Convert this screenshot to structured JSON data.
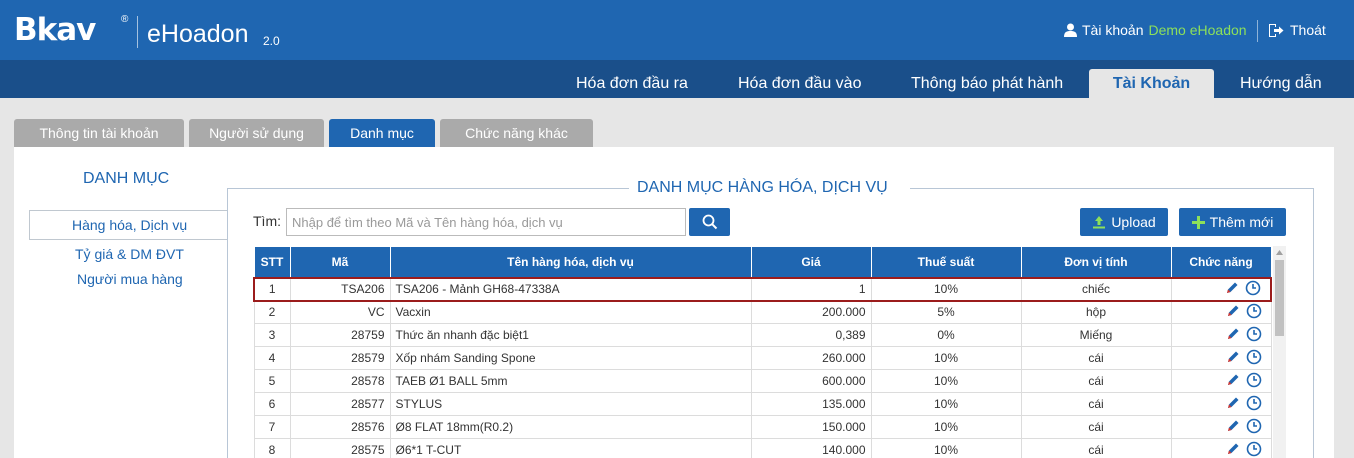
{
  "header": {
    "logo": "Bkav",
    "logo_reg": "®",
    "product": "eHoadon",
    "version": "2.0",
    "account_label": "Tài khoản",
    "account_name": "Demo eHoadon",
    "logout_label": "Thoát"
  },
  "main_nav": {
    "items": [
      "Hóa đơn đầu ra",
      "Hóa đơn đầu vào",
      "Thông báo phát hành",
      "Tài Khoản",
      "Hướng dẫn"
    ],
    "active": "Tài Khoản"
  },
  "sub_tabs": {
    "items": [
      "Thông tin tài khoản",
      "Người sử dụng",
      "Danh mục",
      "Chức năng khác"
    ],
    "active": "Danh mục"
  },
  "left_menu": {
    "title": "DANH MỤC",
    "items": [
      "Hàng hóa, Dịch vụ",
      "Tỷ giá & DM ĐVT",
      "Người mua hàng"
    ],
    "active": "Hàng hóa, Dịch vụ"
  },
  "section_title": "DANH MỤC HÀNG HÓA, DỊCH VỤ",
  "search": {
    "label": "Tìm:",
    "placeholder": "Nhập để tìm theo Mã và Tên hàng hóa, dịch vụ",
    "value": ""
  },
  "buttons": {
    "upload": "Upload",
    "add_new": "Thêm mới"
  },
  "table": {
    "columns": [
      "STT",
      "Mã",
      "Tên hàng hóa, dịch vụ",
      "Giá",
      "Thuế suất",
      "Đơn vị tính",
      "Chức năng"
    ],
    "rows": [
      {
        "stt": "1",
        "ma": "TSA206",
        "ten": "TSA206 - Mảnh GH68-47338A",
        "gia": "1",
        "thue": "10%",
        "dvt": "chiếc",
        "selected": true
      },
      {
        "stt": "2",
        "ma": "VC",
        "ten": "Vacxin",
        "gia": "200.000",
        "thue": "5%",
        "dvt": "hộp"
      },
      {
        "stt": "3",
        "ma": "28759",
        "ten": "Thức ăn nhanh đặc biệt1",
        "gia": "0,389",
        "thue": "0%",
        "dvt": "Miếng"
      },
      {
        "stt": "4",
        "ma": "28579",
        "ten": "Xốp nhám Sanding Spone",
        "gia": "260.000",
        "thue": "10%",
        "dvt": "cái"
      },
      {
        "stt": "5",
        "ma": "28578",
        "ten": "TAEB Ø1 BALL 5mm",
        "gia": "600.000",
        "thue": "10%",
        "dvt": "cái"
      },
      {
        "stt": "6",
        "ma": "28577",
        "ten": "STYLUS",
        "gia": "135.000",
        "thue": "10%",
        "dvt": "cái"
      },
      {
        "stt": "7",
        "ma": "28576",
        "ten": "Ø8 FLAT 18mm(R0.2)",
        "gia": "150.000",
        "thue": "10%",
        "dvt": "cái"
      },
      {
        "stt": "8",
        "ma": "28575",
        "ten": "Ø6*1 T-CUT",
        "gia": "140.000",
        "thue": "10%",
        "dvt": "cái"
      }
    ],
    "row_actions": [
      "edit-icon",
      "history-icon"
    ]
  },
  "colors": {
    "brand": "#1f66b1",
    "nav_dark": "#1a4f8a",
    "account_name": "#8de05a",
    "selected_row_border": "#9b1c1c"
  }
}
